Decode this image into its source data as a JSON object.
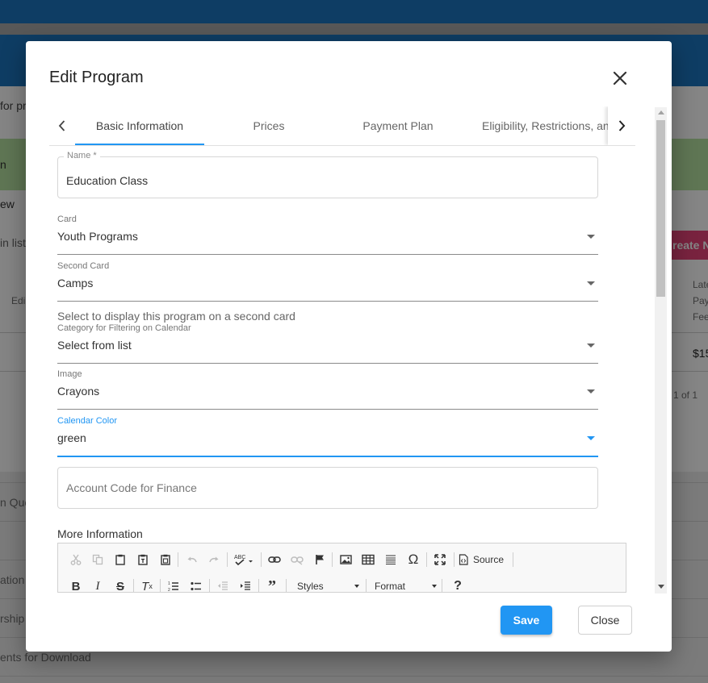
{
  "background": {
    "fragments": {
      "for_pr": "for pr",
      "n": "n",
      "ew": "ew",
      "in_list": "in list",
      "edi": "Edi",
      "create": "reate N",
      "late": "Late",
      "pay": "Pay",
      "fee": "Fee",
      "amount": "$15",
      "pagination": "1 of 1",
      "n_que": "n Que",
      "ation": "ation",
      "rship": "rship",
      "downloads": "ents for Download"
    }
  },
  "modal": {
    "title": "Edit Program",
    "tabs": [
      {
        "label": "Basic Information"
      },
      {
        "label": "Prices"
      },
      {
        "label": "Payment Plan"
      },
      {
        "label": "Eligibility, Restrictions, and Ages"
      }
    ],
    "fields": {
      "name": {
        "label": "Name *",
        "value": "Education Class"
      },
      "card": {
        "label": "Card",
        "value": "Youth Programs"
      },
      "second_card": {
        "label": "Second Card",
        "value": "Camps",
        "helper": "Select to display this program on a second card"
      },
      "category": {
        "label": "Category for Filtering on Calendar",
        "value": "Select from list"
      },
      "image": {
        "label": "Image",
        "value": "Crayons"
      },
      "calendar_color": {
        "label": "Calendar Color",
        "value": "green"
      },
      "account_code": {
        "placeholder": "Account Code for Finance"
      }
    },
    "more_info_label": "More Information",
    "editor": {
      "source_label": "Source",
      "styles_label": "Styles",
      "format_label": "Format"
    },
    "buttons": {
      "save": "Save",
      "close": "Close"
    }
  },
  "colors": {
    "primary": "#2196f3",
    "header_blue": "#1b75c0",
    "banner_green": "#b6e2a1",
    "create_pink": "#e8437a"
  }
}
